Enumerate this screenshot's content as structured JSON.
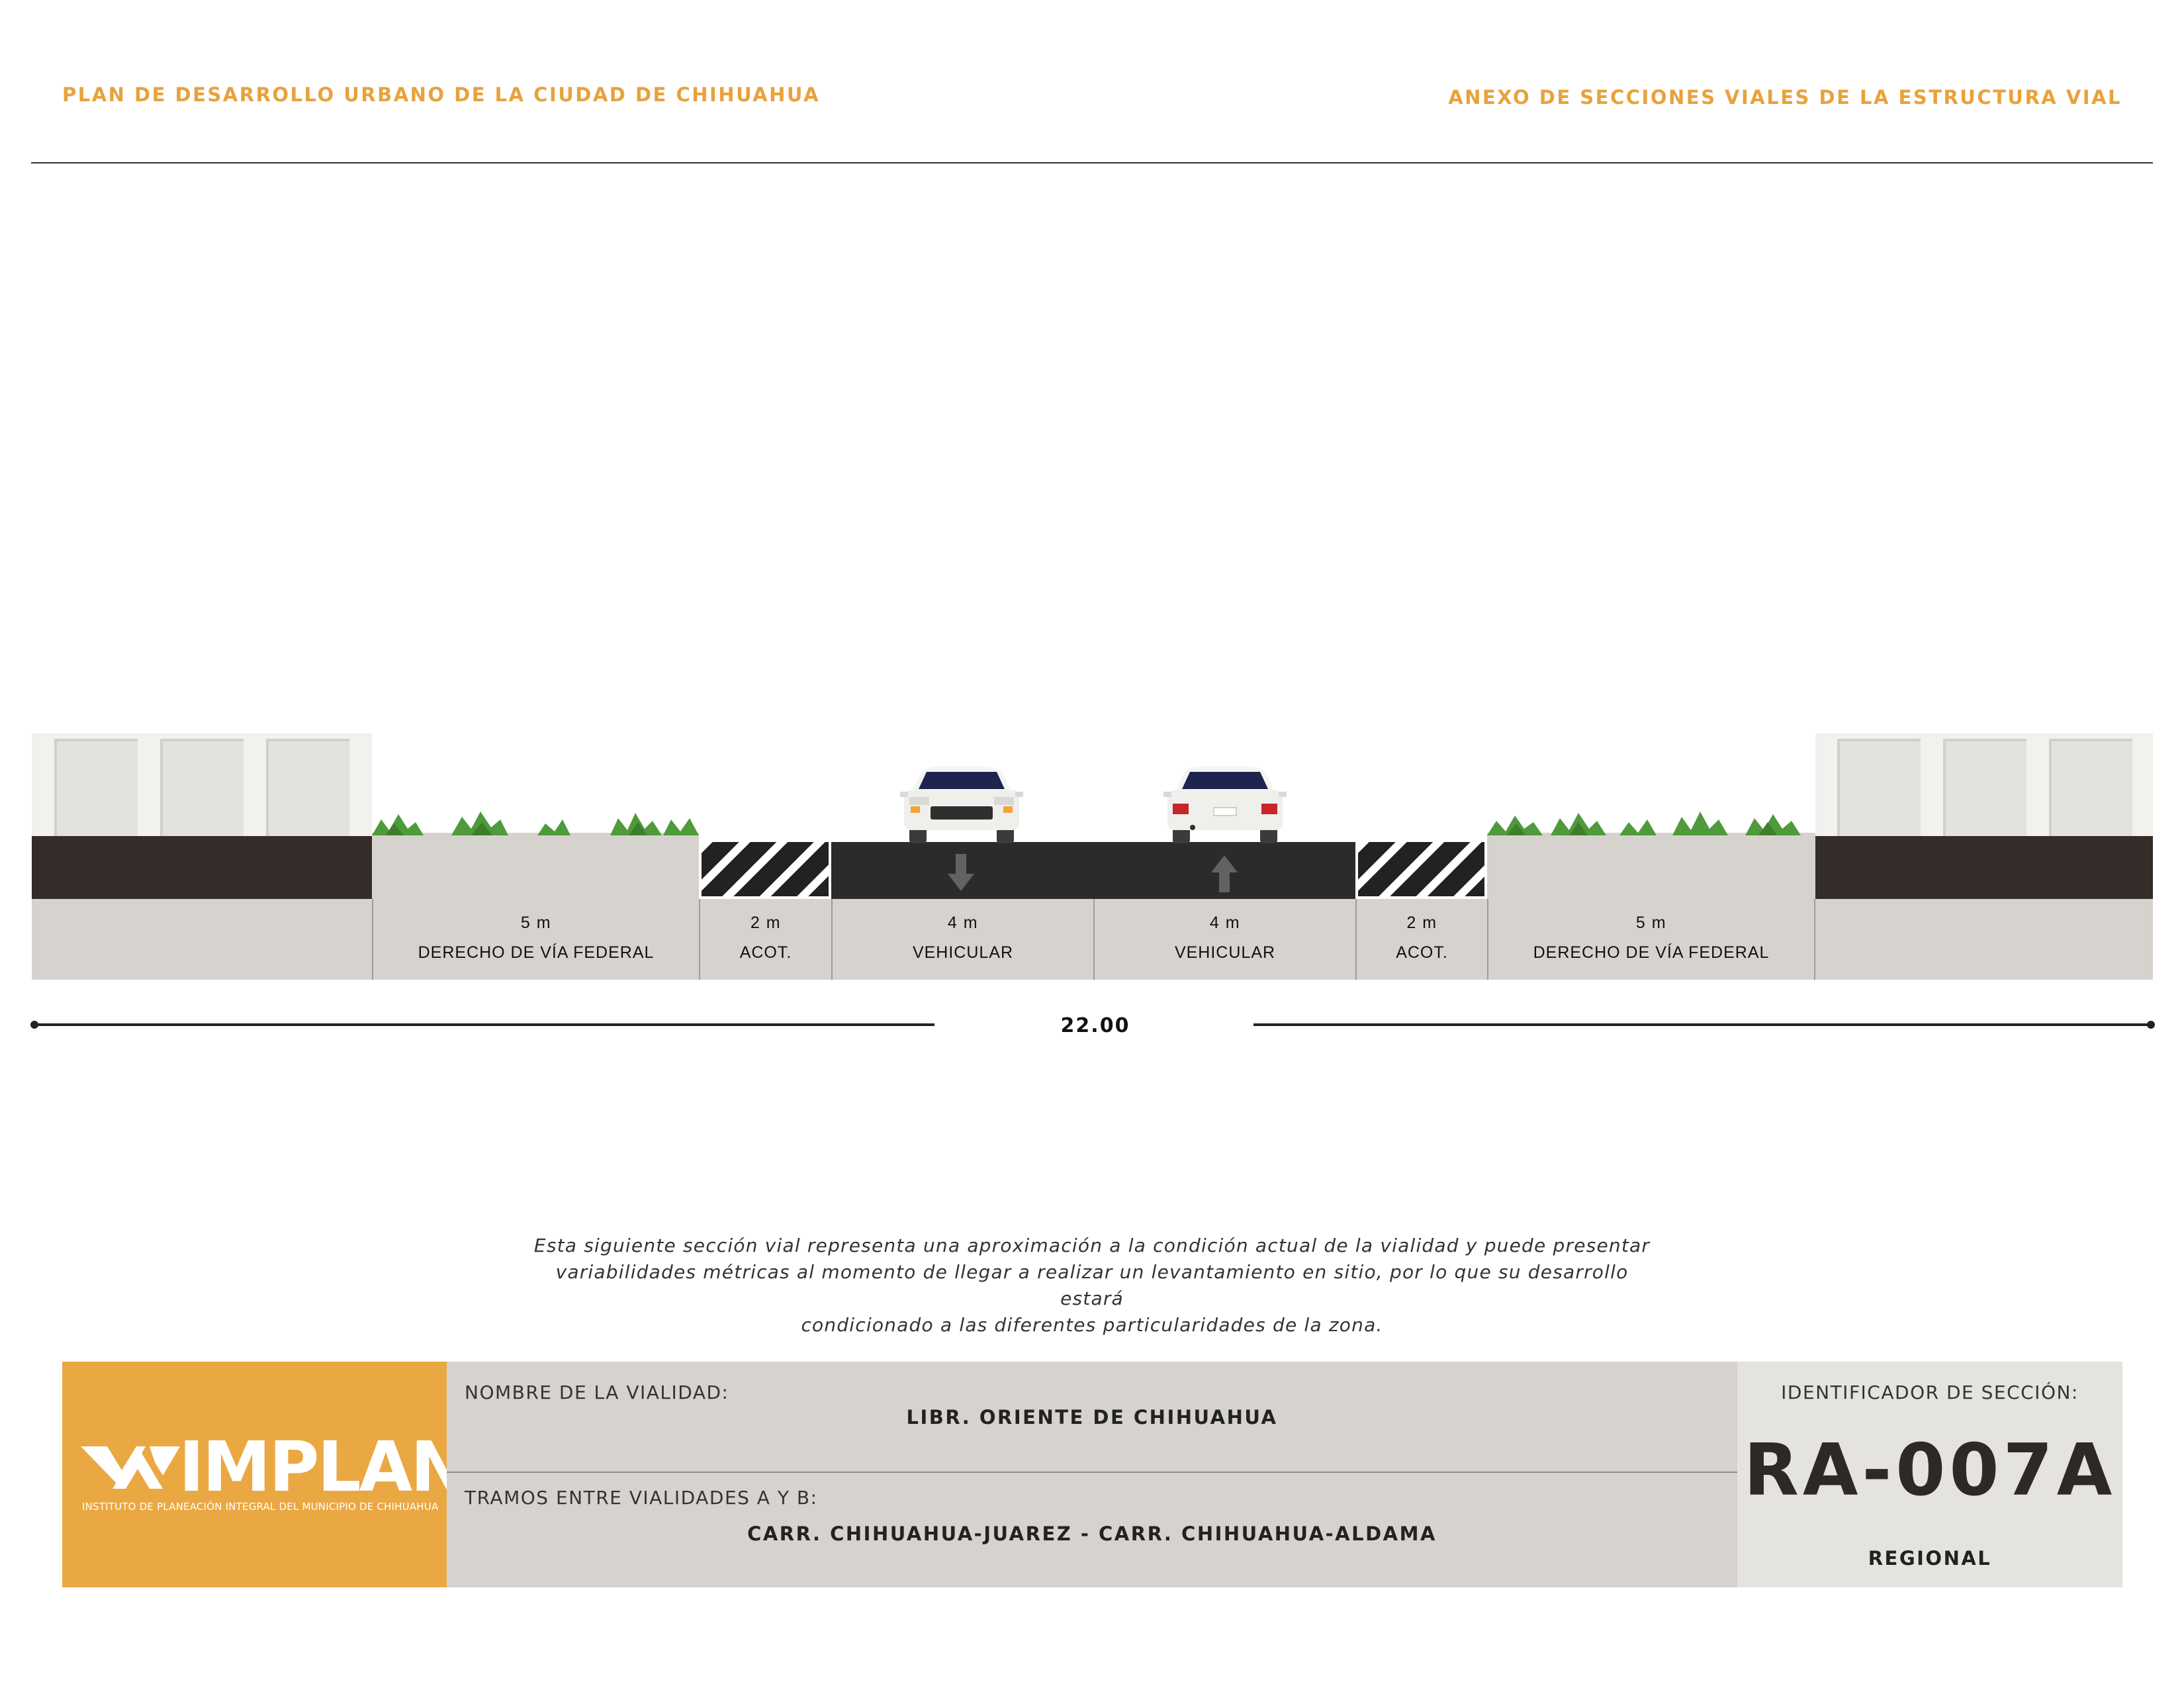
{
  "header": {
    "left_title": "PLAN DE DESARROLLO URBANO DE LA CIUDAD DE CHIHUAHUA",
    "right_title": "ANEXO DE SECCIONES VIALES DE LA ESTRUCTURA VIAL"
  },
  "section": {
    "segments": [
      {
        "width_label": "5 m",
        "name": "DERECHO DE VÍA FEDERAL"
      },
      {
        "width_label": "2 m",
        "name": "ACOT."
      },
      {
        "width_label": "4 m",
        "name": "VEHICULAR"
      },
      {
        "width_label": "4 m",
        "name": "VEHICULAR"
      },
      {
        "width_label": "2 m",
        "name": "ACOT."
      },
      {
        "width_label": "5 m",
        "name": "DERECHO DE VÍA FEDERAL"
      }
    ],
    "total_width": "22.00"
  },
  "note": {
    "line1": "Esta siguiente sección vial representa una aproximación a la condición actual de la vialidad y puede presentar",
    "line2": "variabilidades métricas al momento de llegar a realizar un levantamiento en sitio, por lo que su desarrollo estará",
    "line3": "condicionado a las diferentes particularidades de la zona."
  },
  "title_block": {
    "logo_text": "IMPLAN",
    "logo_subtitle": "INSTITUTO DE PLANEACIÓN INTEGRAL DEL MUNICIPIO DE CHIHUAHUA",
    "road_name_label": "NOMBRE DE LA VIALIDAD:",
    "road_name": "LIBR. ORIENTE DE CHIHUAHUA",
    "segment_label": "TRAMOS ENTRE VIALIDADES A Y B:",
    "segment_value": "CARR. CHIHUAHUA-JUAREZ - CARR. CHIHUAHUA-ALDAMA",
    "id_label": "IDENTIFICADOR DE SECCIÓN:",
    "id_value": "RA-007A",
    "classification": "REGIONAL"
  },
  "colors": {
    "accent": "#e8a23c",
    "logo_bg": "#eaa843",
    "asphalt": "#2b2c2a",
    "soil": "#342c28",
    "grey_base": "#d6d3ce",
    "vegetation": "#4f9a3a"
  },
  "icons": [
    "arrow-down-icon",
    "arrow-up-icon",
    "car-front-icon",
    "car-rear-icon",
    "shrub-icon",
    "implan-logo-icon"
  ]
}
